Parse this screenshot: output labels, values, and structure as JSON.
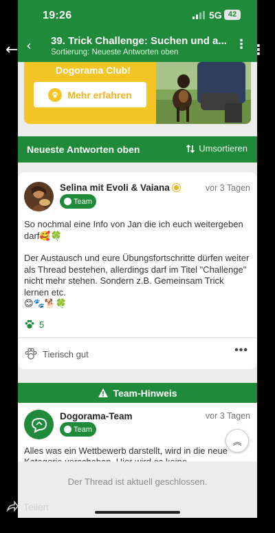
{
  "status_bar": {
    "time": "19:26",
    "network": "5G",
    "battery": "42"
  },
  "app_bar": {
    "title": "39. Trick Challenge: Suchen und a...",
    "subtitle": "Sortierung: Neueste Antworten oben",
    "back_icon": "chevron-left-icon",
    "more_icon": "more-vertical-icon"
  },
  "promo": {
    "club_text": "Dogorama Club!",
    "button_label": "Mehr erfahren"
  },
  "sort_bar": {
    "label": "Neueste Antworten oben",
    "resort_label": "Umsortieren"
  },
  "post": {
    "author": "Selina mit Evoli & Vaiana",
    "badge": "Team",
    "time": "vor 3 Tagen",
    "text_1": "So nochmal eine Info von Jan die ich euch weitergeben darf🥰🍀",
    "text_2": "Der Austausch und eure Übungsfortschritte dürfen weiter als Thread bestehen, allerdings darf im Titel \"Challenge\" nicht mehr stehen. Sondern z.B. Gemeinsam Trick lernen etc.",
    "text_3": "😊🐾🐕🍀",
    "likes_count": "5",
    "reaction_label": "Tierisch gut"
  },
  "team_hint": {
    "bar_label": "Team-Hinweis",
    "author": "Dogorama-Team",
    "badge": "Team",
    "time": "vor 3 Tagen",
    "text": "Alles was ein Wettbewerb darstellt, wird in die neue Kategorie verschoben. Hier wird es keine"
  },
  "closed_notice": "Der Thread ist aktuell geschlossen.",
  "share_label": "Teilen",
  "colors": {
    "brand_green": "#1f8a39",
    "promo_yellow": "#f3c526",
    "background": "#ececec"
  }
}
